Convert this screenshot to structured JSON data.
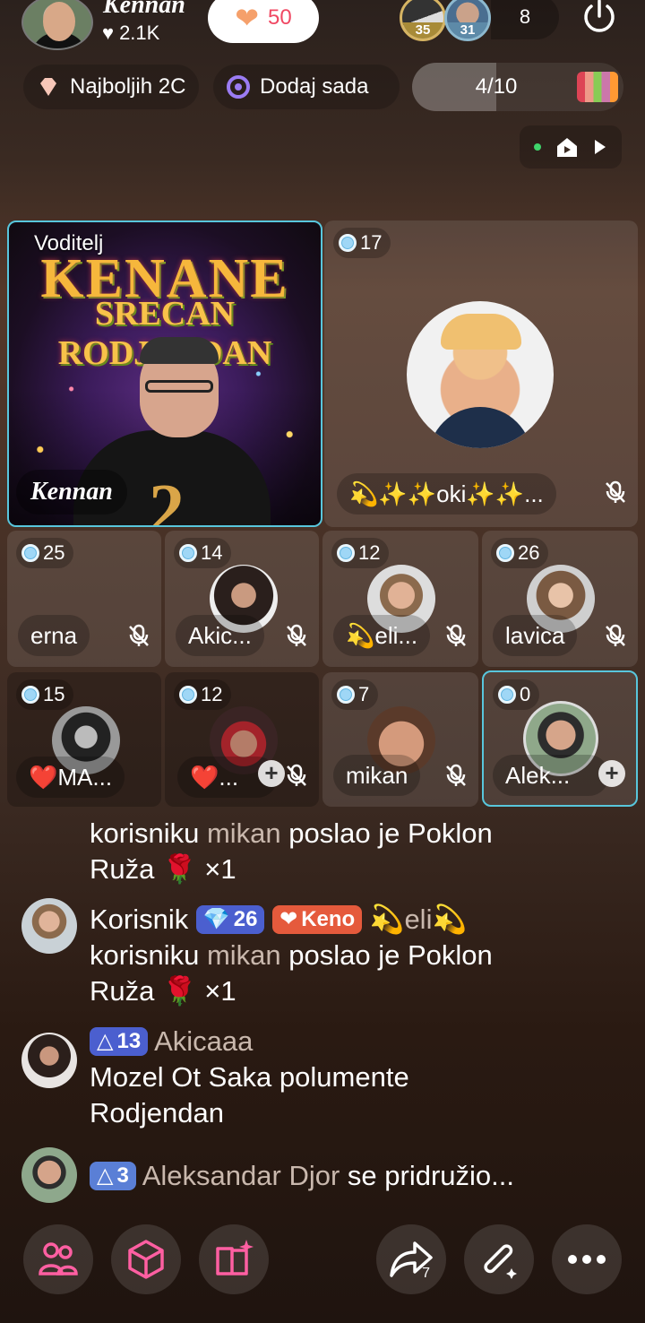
{
  "header": {
    "host_name": "Kennan",
    "host_likes": "2.1K",
    "heart_count": "50",
    "viewers": [
      {
        "level": "35"
      },
      {
        "level": "31"
      }
    ],
    "viewer_count": "8"
  },
  "chips": {
    "ranking_label": "Najboljih 2C",
    "add_label": "Dodaj sada",
    "progress_label": "4/10",
    "progress_value": 0.4
  },
  "stage": {
    "host_tile": {
      "role_label": "Voditelj",
      "poster_line1": "KENANE",
      "poster_line2": "SRECAN RODJENDAN",
      "poster_digit": "2",
      "name": "Kennan"
    },
    "guest_main": {
      "level": "17",
      "name": "💫✨✨oki✨✨..."
    },
    "row1": [
      {
        "level": "25",
        "name": "erna"
      },
      {
        "level": "14",
        "name": "Akic..."
      },
      {
        "level": "12",
        "name": "💫eli..."
      },
      {
        "level": "26",
        "name": "lavica"
      }
    ],
    "row2": [
      {
        "level": "15",
        "name": "❤️MA..."
      },
      {
        "level": "12",
        "name": "❤️..."
      },
      {
        "level": "7",
        "name": "mikan"
      },
      {
        "level": "0",
        "name": "Alek..."
      }
    ]
  },
  "chat": {
    "m0": {
      "prefix": "korisniku",
      "target": "mikan",
      "action": "poslao je Poklon",
      "gift": "Ruža",
      "gift_icon": "🌹",
      "count": "×1"
    },
    "m1": {
      "user_prefix": "Korisnik",
      "badge_level": "26",
      "badge_name": "Keno",
      "sender": "💫eli💫",
      "prefix": "korisniku",
      "target": "mikan",
      "action": "poslao je Poklon",
      "gift": "Ruža",
      "gift_icon": "🌹",
      "count": "×1"
    },
    "m2": {
      "badge_level": "13",
      "sender": "Akicaaa",
      "text1": "Mozel Ot Saka polumente",
      "text2": "Rodjendan"
    },
    "m3": {
      "badge_level": "3",
      "sender": "Aleksandar Djor",
      "text": "se pridružio..."
    }
  },
  "bottom_bar": {
    "share_count": "7"
  }
}
